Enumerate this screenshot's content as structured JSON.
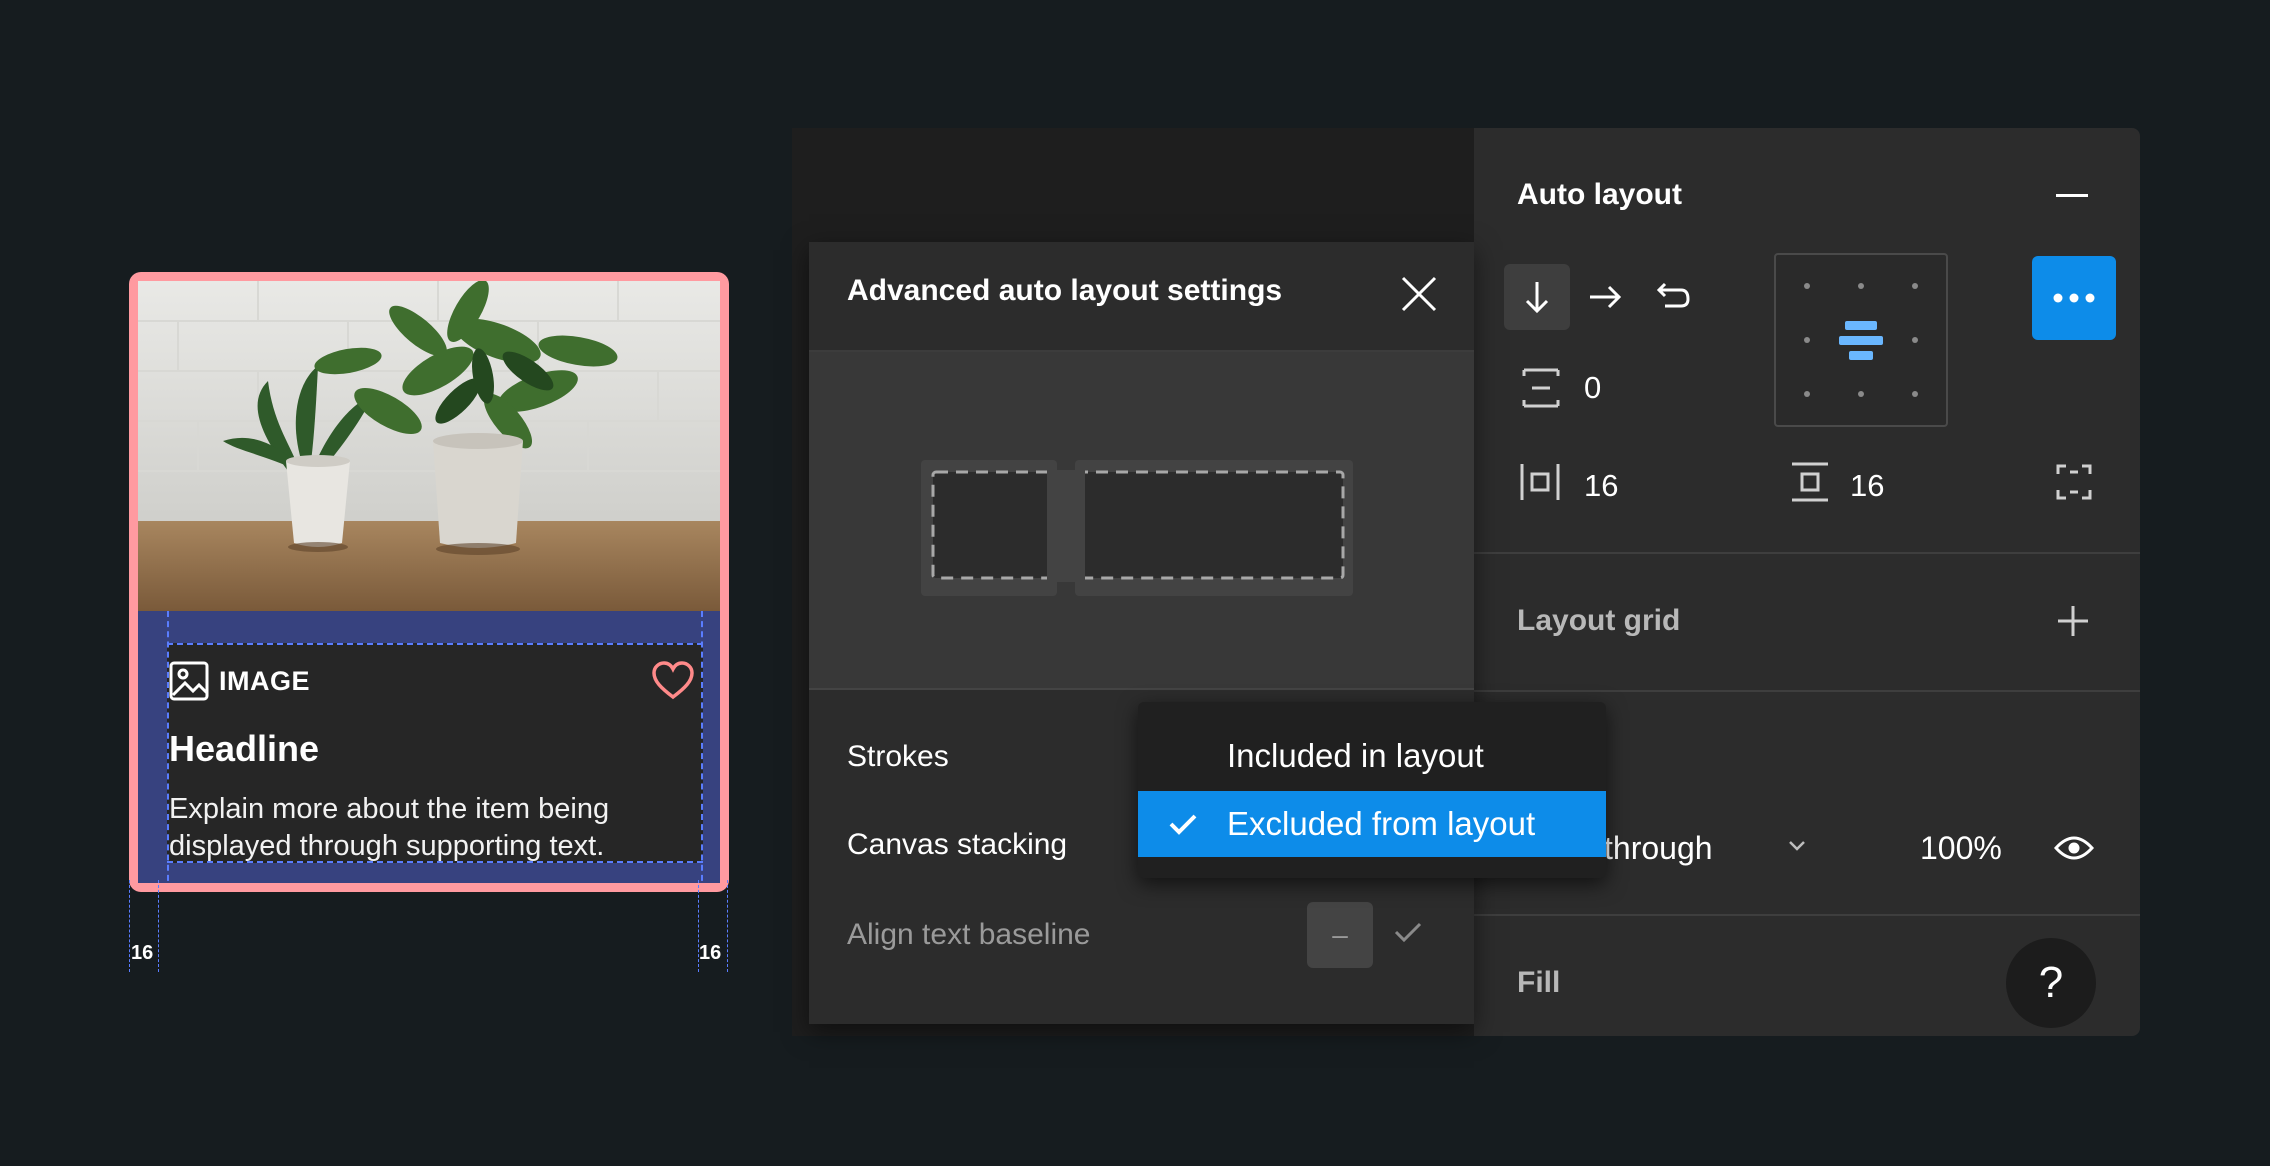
{
  "card": {
    "tag_label": "IMAGE",
    "headline": "Headline",
    "body": "Explain more about the item being displayed through supporting text.",
    "padding_left": "16",
    "padding_right": "16",
    "border_color": "#ff9aa0"
  },
  "modal": {
    "title": "Advanced auto layout settings",
    "strokes_label": "Strokes",
    "canvas_stacking_label": "Canvas stacking",
    "align_baseline_label": "Align text baseline",
    "align_baseline_value": "–"
  },
  "dropdown": {
    "options": [
      {
        "label": "Included in layout",
        "selected": false
      },
      {
        "label": "Excluded from layout",
        "selected": true
      }
    ]
  },
  "panel": {
    "auto_layout_title": "Auto layout",
    "spacing_between": "0",
    "padding_horizontal": "16",
    "padding_vertical": "16",
    "layout_grid_title": "Layout grid",
    "blend_mode": "Pass through",
    "opacity": "100%",
    "fill_title": "Fill",
    "help_label": "?"
  },
  "colors": {
    "accent": "#0d8ce9",
    "background": "#161c1f",
    "panel": "#2c2c2c"
  }
}
